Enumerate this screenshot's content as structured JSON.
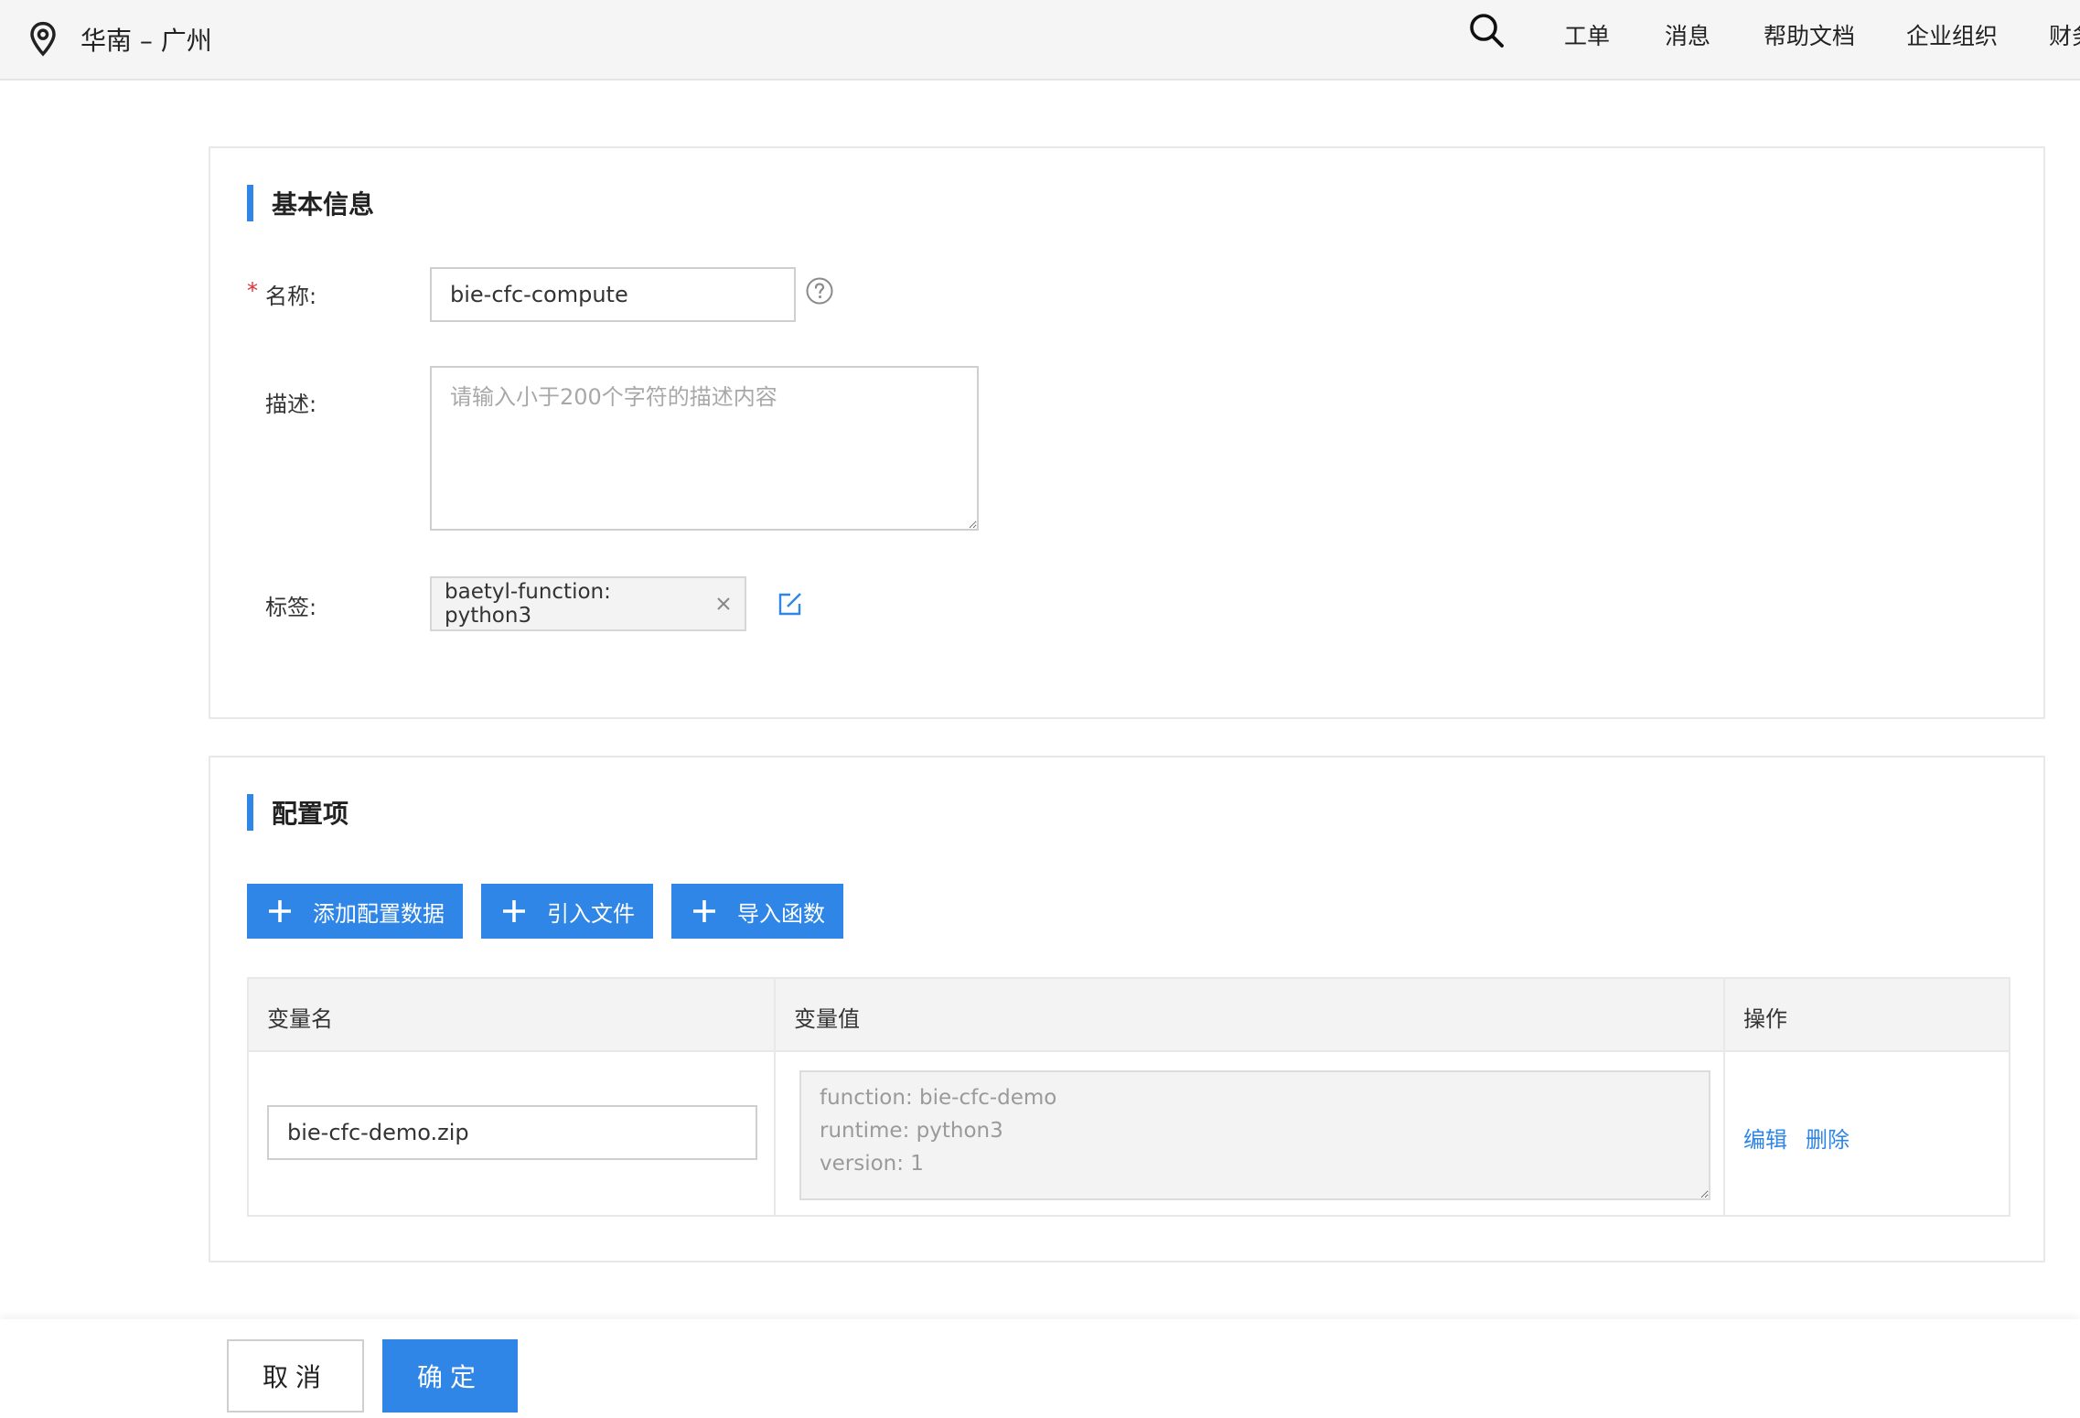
{
  "header": {
    "region": "华南 – 广州",
    "nav": [
      "工单",
      "消息",
      "帮助文档",
      "企业组织",
      "财务"
    ]
  },
  "basic_info": {
    "title": "基本信息",
    "name_label": "名称:",
    "name_value": "bie-cfc-compute",
    "desc_label": "描述:",
    "desc_placeholder": "请输入小于200个字符的描述内容",
    "tags_label": "标签:",
    "tag": "baetyl-function: python3"
  },
  "config": {
    "title": "配置项",
    "buttons": [
      "添加配置数据",
      "引入文件",
      "导入函数"
    ],
    "columns": [
      "变量名",
      "变量值",
      "操作"
    ],
    "rows": [
      {
        "name": "bie-cfc-demo.zip",
        "value": "function: bie-cfc-demo\nruntime: python3\nversion: 1",
        "actions": [
          "编辑",
          "删除"
        ]
      }
    ]
  },
  "footer": {
    "cancel": "取消",
    "confirm": "确定"
  },
  "colors": {
    "accent": "#2f86e6",
    "required": "#e0303a"
  }
}
